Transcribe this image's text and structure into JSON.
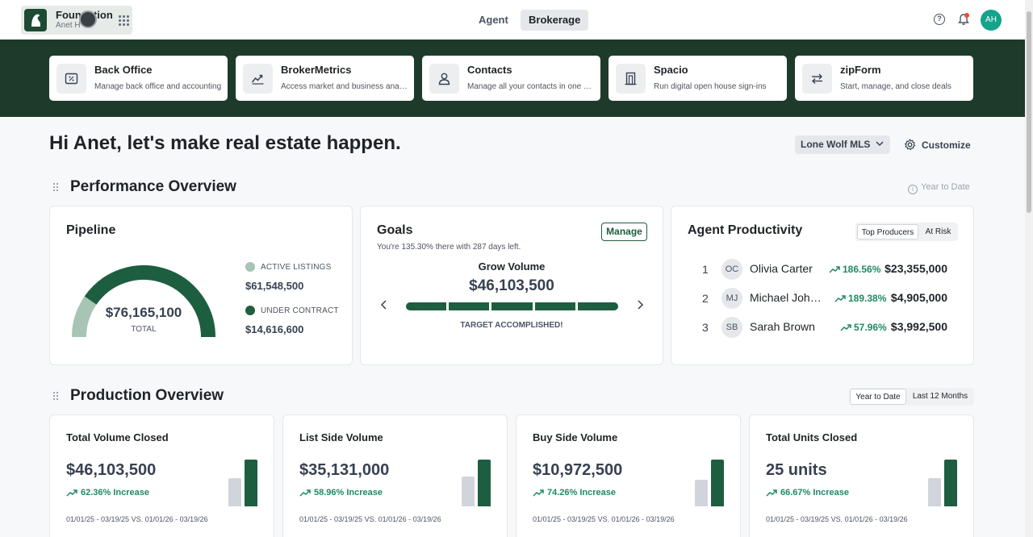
{
  "topbar": {
    "org_name": "Foundation",
    "user_name": "Anet H",
    "mode_tabs": [
      "Agent",
      "Brokerage"
    ],
    "active_mode": "Brokerage",
    "avatar_initials": "AH"
  },
  "apps": [
    {
      "title": "Back Office",
      "description": "Manage back office and accounting",
      "icon": "percent-doc-icon"
    },
    {
      "title": "BrokerMetrics",
      "description": "Access market and business analytics",
      "icon": "chart-icon"
    },
    {
      "title": "Contacts",
      "description": "Manage all your contacts in one place",
      "icon": "person-icon"
    },
    {
      "title": "Spacio",
      "description": "Run digital open house sign-ins",
      "icon": "door-icon"
    },
    {
      "title": "zipForm",
      "description": "Start, manage, and close deals",
      "icon": "swap-arrows-icon"
    }
  ],
  "greeting": "Hi Anet, let's make real estate happen.",
  "mls_select": "Lone Wolf MLS",
  "customize_label": "Customize",
  "performance": {
    "title": "Performance Overview",
    "period_note": "Year to Date",
    "pipeline": {
      "title": "Pipeline",
      "total_value": "$76,165,100",
      "total_label": "TOTAL",
      "legend": [
        {
          "label": "ACTIVE LISTINGS",
          "value": "$61,548,500",
          "color": "#a7c4b5"
        },
        {
          "label": "UNDER CONTRACT",
          "value": "$14,616,600",
          "color": "#1e5e40"
        }
      ],
      "under_contract_fraction": 0.192
    },
    "goals": {
      "title": "Goals",
      "manage_label": "Manage",
      "subtitle": "You're 135.30% there with 287 days left.",
      "goal_name": "Grow Volume",
      "goal_value": "$46,103,500",
      "status": "TARGET ACCOMPLISHED!",
      "progress_fraction": 1.0
    },
    "agent_productivity": {
      "title": "Agent Productivity",
      "toggle": [
        "Top Producers",
        "At Risk"
      ],
      "active_toggle": "Top Producers",
      "rows": [
        {
          "rank": "1",
          "initials": "OC",
          "name": "Olivia Carter",
          "change": "186.56%",
          "amount": "$23,355,000"
        },
        {
          "rank": "2",
          "initials": "MJ",
          "name": "Michael Johnson",
          "change": "189.38%",
          "amount": "$4,905,000"
        },
        {
          "rank": "3",
          "initials": "SB",
          "name": "Sarah Brown",
          "change": "57.96%",
          "amount": "$3,992,500"
        }
      ]
    }
  },
  "production": {
    "title": "Production Overview",
    "toggle": [
      "Year to Date",
      "Last 12 Months"
    ],
    "active_toggle": "Year to Date",
    "metrics": [
      {
        "title": "Total Volume Closed",
        "value": "$46,103,500",
        "trend": "62.36% Increase",
        "dates": "01/01/25 - 03/19/25 VS. 01/01/26 - 03/19/26",
        "prev_fraction": 0.6,
        "curr_fraction": 1.0
      },
      {
        "title": "List Side Volume",
        "value": "$35,131,000",
        "trend": "58.96% Increase",
        "dates": "01/01/25 - 03/19/25 VS. 01/01/26 - 03/19/26",
        "prev_fraction": 0.63,
        "curr_fraction": 1.0
      },
      {
        "title": "Buy Side Volume",
        "value": "$10,972,500",
        "trend": "74.26% Increase",
        "dates": "01/01/25 - 03/19/25 VS. 01/01/26 - 03/19/26",
        "prev_fraction": 0.57,
        "curr_fraction": 1.0
      },
      {
        "title": "Total Units Closed",
        "value": "25 units",
        "trend": "66.67% Increase",
        "dates": "01/01/25 - 03/19/25 VS. 01/01/26 - 03/19/26",
        "prev_fraction": 0.6,
        "curr_fraction": 1.0
      }
    ]
  },
  "colors": {
    "brand_dark": "#1e3a2a",
    "accent_green": "#1e5e40",
    "positive": "#1f8a63",
    "light_green": "#a7c4b5"
  }
}
